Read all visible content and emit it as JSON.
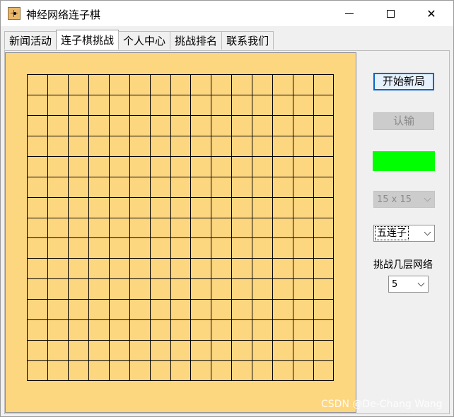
{
  "window": {
    "title": "神经网络连子棋"
  },
  "tabs": [
    {
      "label": "新闻活动"
    },
    {
      "label": "连子棋挑战"
    },
    {
      "label": "个人中心"
    },
    {
      "label": "挑战排名"
    },
    {
      "label": "联系我们"
    }
  ],
  "active_tab": "连子棋挑战",
  "board": {
    "size": 15,
    "color": "#fdd680",
    "line_color": "#000000"
  },
  "controls": {
    "new_game_label": "开始新局",
    "resign_label": "认输",
    "status_color": "#00ff00",
    "board_size_value": "15 x 15",
    "mode_value": "五连子",
    "layers_label": "挑战几层网络",
    "layers_value": "5"
  },
  "watermark": "CSDN @De-Chang Wang"
}
